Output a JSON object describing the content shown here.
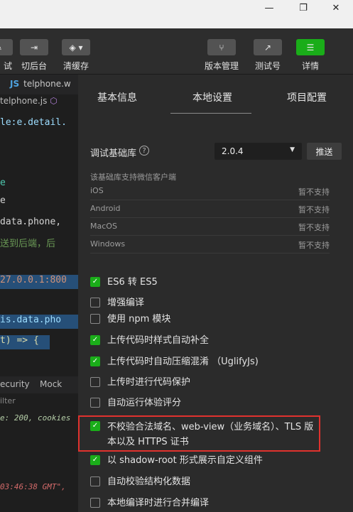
{
  "window": {
    "minimize": "—",
    "maximize": "❐",
    "close": "✕"
  },
  "toolbar": {
    "items": [
      {
        "label": "试",
        "icon": "pencil-icon"
      },
      {
        "label": "切后台",
        "icon": "switch-background-icon"
      },
      {
        "label": "清缓存",
        "icon": "layers-icon"
      },
      {
        "label": "版本管理",
        "icon": "branch-icon"
      },
      {
        "label": "测试号",
        "icon": "external-link-icon"
      },
      {
        "label": "详情",
        "icon": "menu-icon"
      }
    ]
  },
  "editor": {
    "tab": "telphone.w",
    "breadcrumb": "telphone.js",
    "lines": [
      {
        "text": "le:e.detail.",
        "color": "#9cdcfe"
      },
      {
        "text": "e",
        "color": "#4ec9b0"
      },
      {
        "text": "e",
        "color": "#d4d4d4"
      },
      {
        "text": "data.phone,",
        "color": "#d4d4d4"
      },
      {
        "text": "送到后端，后",
        "color": "#6a9955"
      },
      {
        "text": "27.0.0.1:800",
        "color": "#ce9178"
      },
      {
        "text": "is.data.pho",
        "color": "#9cdcfe"
      },
      {
        "text": "t) => {",
        "color": "#dcdcaa"
      }
    ],
    "devtools_tabs": [
      "ecurity",
      "Mock"
    ],
    "filter": "ilter",
    "console": [
      {
        "text": "e: 200, cookies",
        "color": "#b5cea8"
      },
      {
        "text": "03:46:38 GMT\",",
        "color": "#d16969"
      }
    ]
  },
  "panel": {
    "tabs": [
      "基本信息",
      "本地设置",
      "项目配置"
    ],
    "active_tab": "本地设置",
    "lib_label": "调试基础库",
    "help": "?",
    "lib_version": "2.0.4",
    "push_label": "推送",
    "support_note": "该基础库支持微信客户端",
    "os_support": [
      {
        "name": "iOS",
        "status": "暂不支持"
      },
      {
        "name": "Android",
        "status": "暂不支持"
      },
      {
        "name": "MacOS",
        "status": "暂不支持"
      },
      {
        "name": "Windows",
        "status": "暂不支持"
      }
    ],
    "options": [
      {
        "label": "ES6 转 ES5",
        "checked": true
      },
      {
        "label": "增强编译",
        "checked": false
      },
      {
        "label": "使用 npm 模块",
        "checked": false
      },
      {
        "label": "上传代码时样式自动补全",
        "checked": true
      },
      {
        "label": "上传代码时自动压缩混淆 （UglifyJs)",
        "checked": true
      },
      {
        "label": "上传时进行代码保护",
        "checked": false
      },
      {
        "label": "自动运行体验评分",
        "checked": false
      },
      {
        "label": "不校验合法域名、web-view（业务域名）、TLS 版本以及 HTTPS 证书",
        "checked": true
      },
      {
        "label": "以 shadow-root 形式展示自定义组件",
        "checked": true
      },
      {
        "label": "自动校验结构化数据",
        "checked": false
      },
      {
        "label": "本地编译时进行合并编译",
        "checked": false
      }
    ]
  },
  "colors": {
    "accent": "#1aad19",
    "highlight_border": "#e0322e"
  }
}
